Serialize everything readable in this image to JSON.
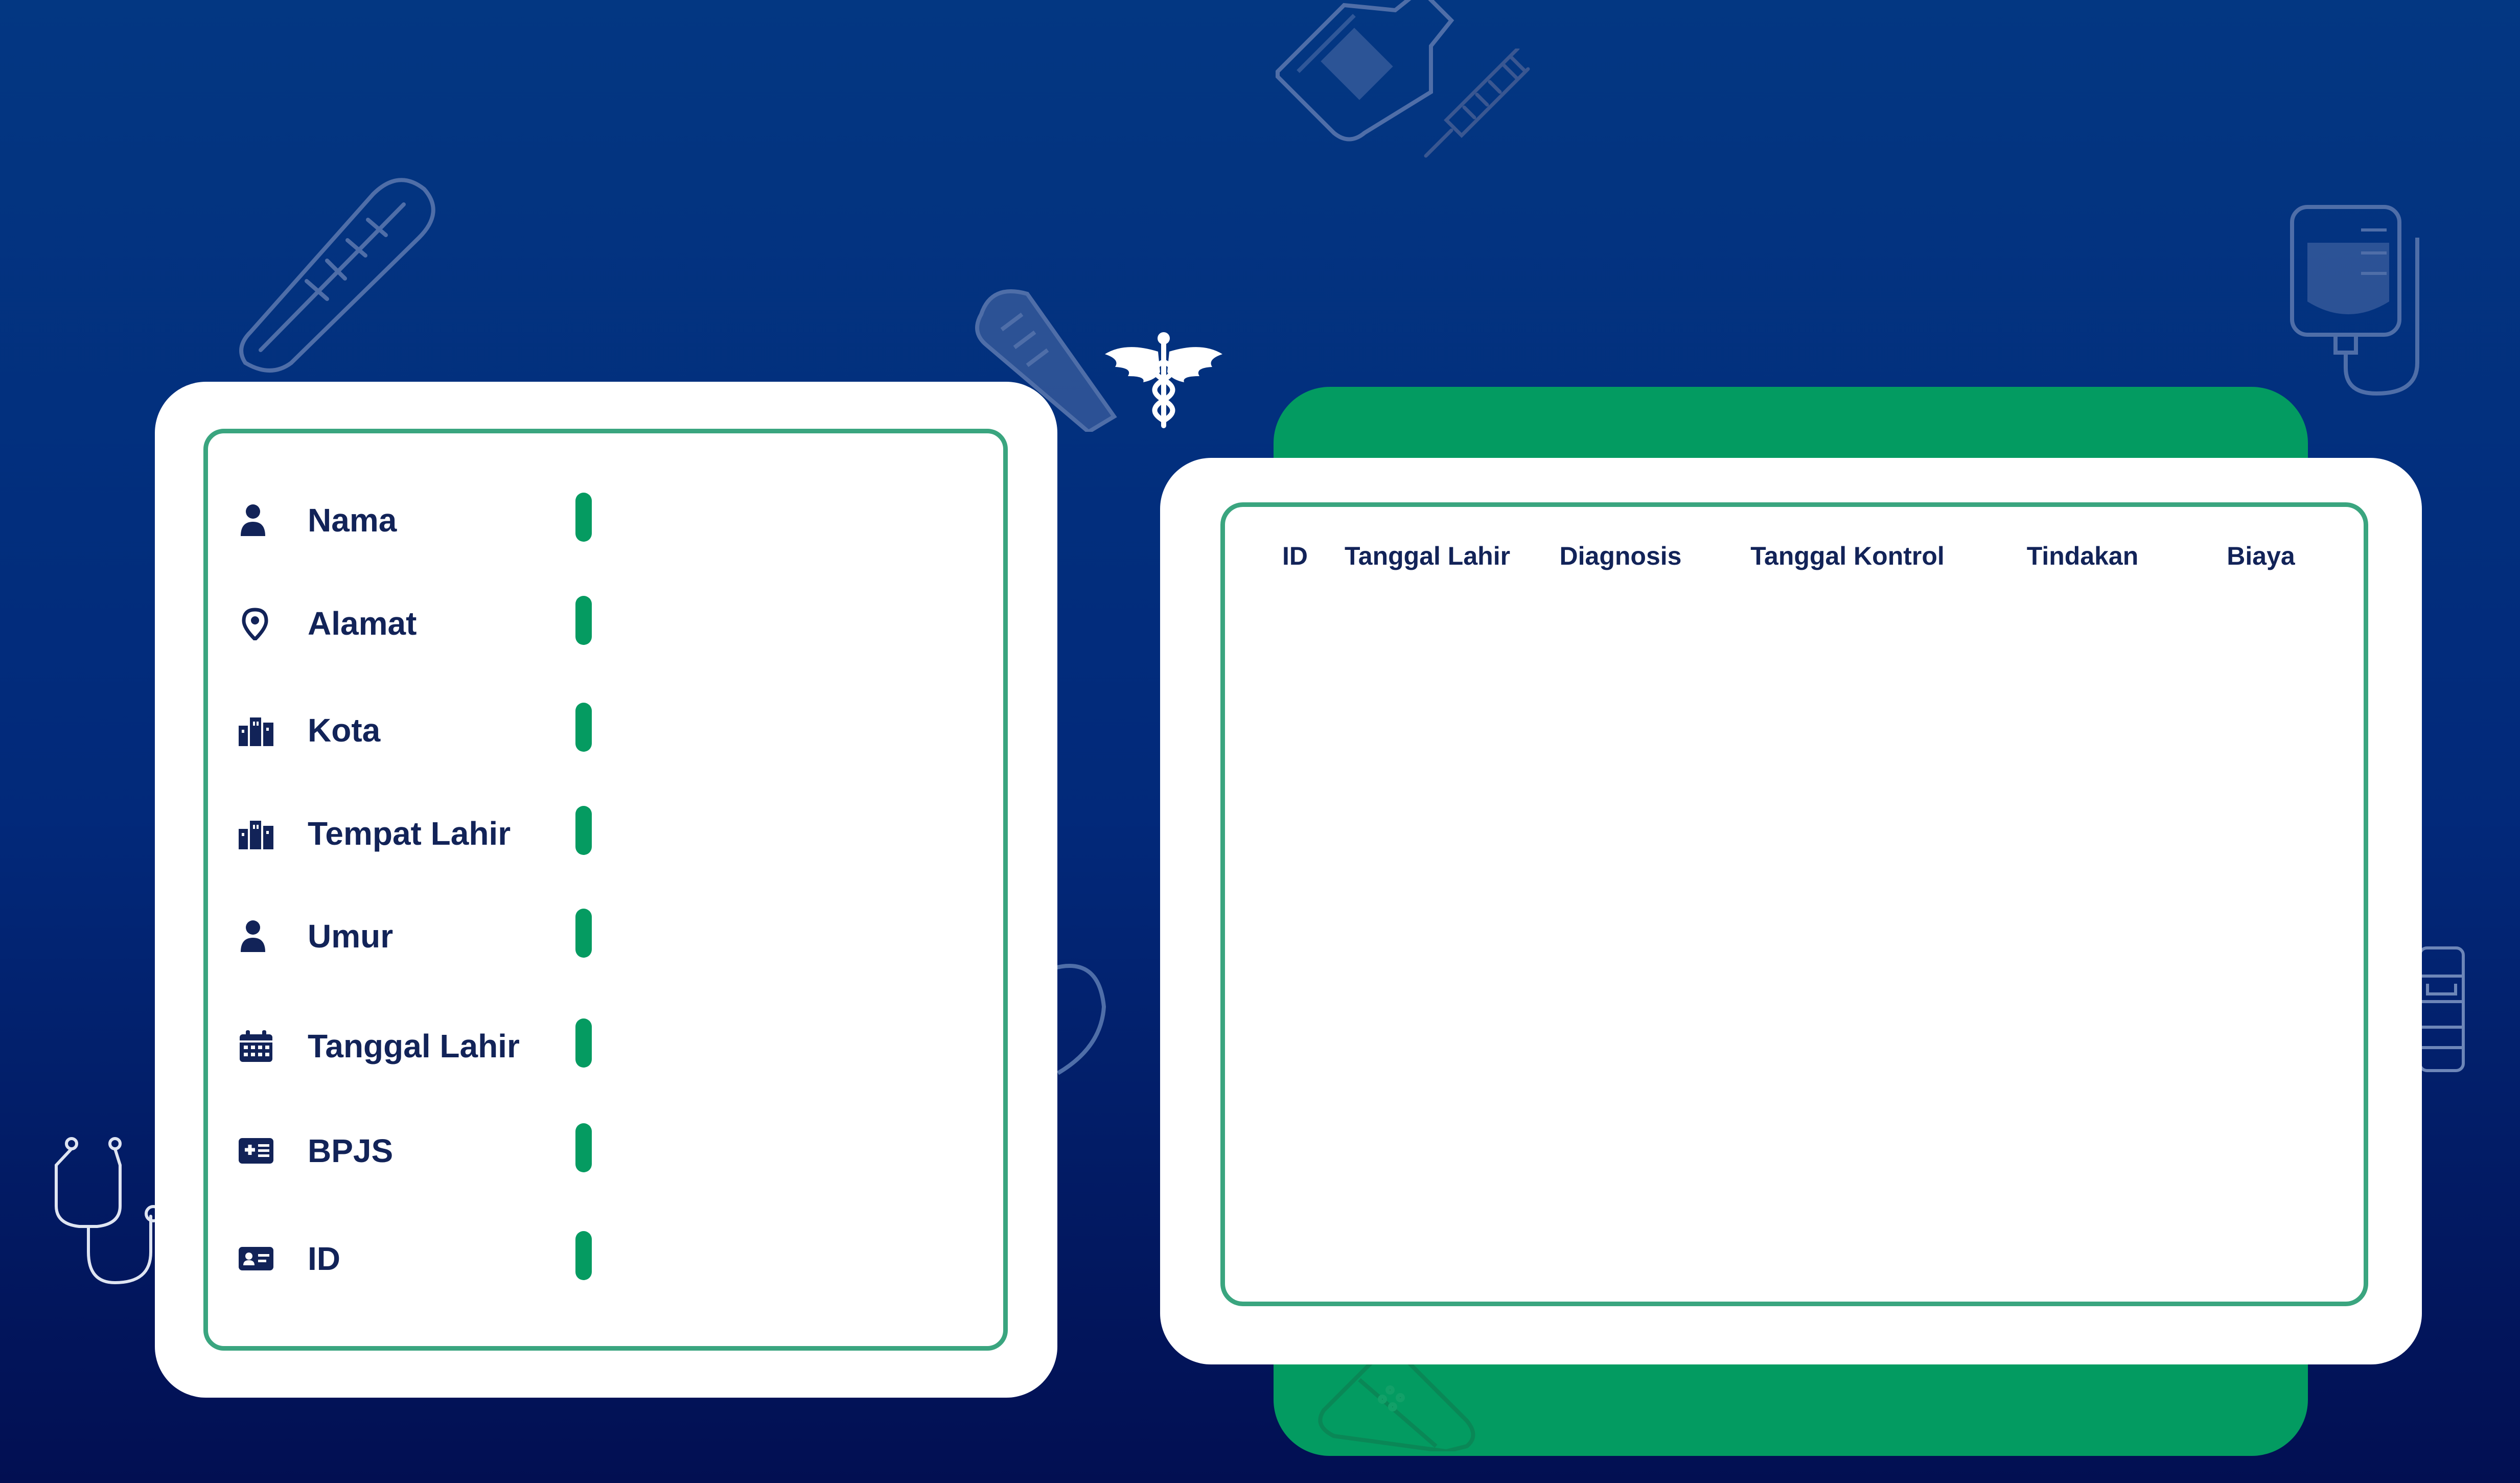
{
  "colors": {
    "background_top": "#033782",
    "background_bottom": "#020f52",
    "panel": "#ffffff",
    "panel_border": "#3aa57f",
    "accent_green": "#059b61",
    "text": "#122358"
  },
  "patient_form": {
    "fields": [
      {
        "icon": "user-icon",
        "label": "Nama"
      },
      {
        "icon": "map-pin-icon",
        "label": "Alamat"
      },
      {
        "icon": "city-icon",
        "label": "Kota"
      },
      {
        "icon": "city-icon",
        "label": "Tempat Lahir"
      },
      {
        "icon": "user-icon",
        "label": "Umur"
      },
      {
        "icon": "calendar-icon",
        "label": "Tanggal Lahir"
      },
      {
        "icon": "health-card-icon",
        "label": "BPJS"
      },
      {
        "icon": "id-card-icon",
        "label": "ID"
      }
    ]
  },
  "records_table": {
    "columns": [
      "ID",
      "Tanggal Lahir",
      "Diagnosis",
      "Tanggal Kontrol",
      "Tindakan",
      "Biaya"
    ],
    "rows": []
  },
  "logo": {
    "icon": "caduceus-icon"
  }
}
